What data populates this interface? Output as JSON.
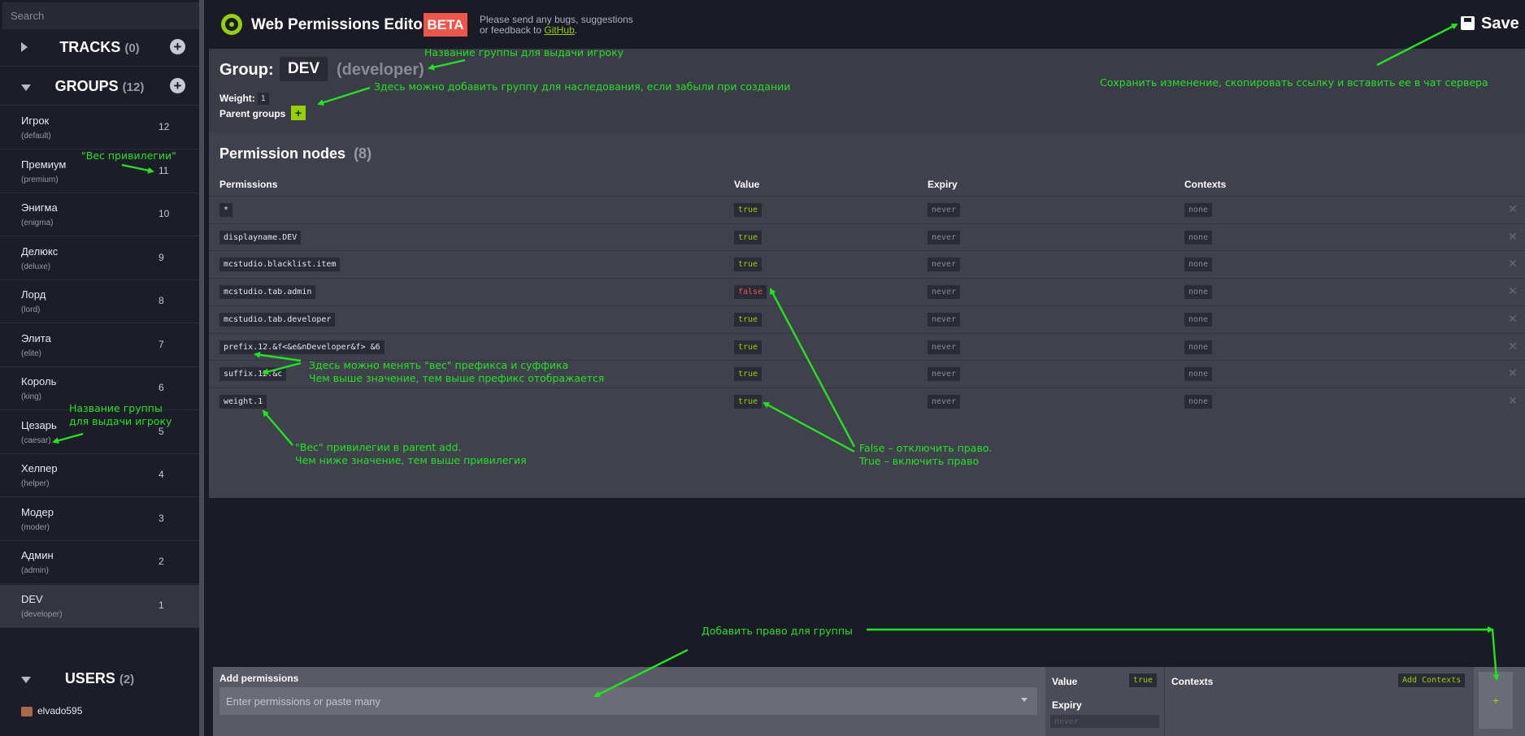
{
  "sidebar": {
    "search_placeholder": "Search",
    "tracks": {
      "title": "TRACKS",
      "count": "(0)"
    },
    "groups": {
      "title": "GROUPS",
      "count": "(12)",
      "items": [
        {
          "name": "Игрок",
          "id": "(default)",
          "weight": "12"
        },
        {
          "name": "Премиум",
          "id": "(premium)",
          "weight": "11"
        },
        {
          "name": "Энигма",
          "id": "(enigma)",
          "weight": "10"
        },
        {
          "name": "Делюкс",
          "id": "(deluxe)",
          "weight": "9"
        },
        {
          "name": "Лорд",
          "id": "(lord)",
          "weight": "8"
        },
        {
          "name": "Элита",
          "id": "(elite)",
          "weight": "7"
        },
        {
          "name": "Король",
          "id": "(king)",
          "weight": "6"
        },
        {
          "name": "Цезарь",
          "id": "(caesar)",
          "weight": "5"
        },
        {
          "name": "Хелпер",
          "id": "(helper)",
          "weight": "4"
        },
        {
          "name": "Модер",
          "id": "(moder)",
          "weight": "3"
        },
        {
          "name": "Админ",
          "id": "(admin)",
          "weight": "2"
        },
        {
          "name": "DEV",
          "id": "(developer)",
          "weight": "1",
          "active": true
        }
      ]
    },
    "users": {
      "title": "USERS",
      "count": "(2)",
      "items": [
        {
          "name": "elvado595"
        }
      ]
    }
  },
  "header": {
    "app_title": "Web Permissions Editor",
    "beta": "BETA",
    "feedback_line1": "Please send any bugs, suggestions",
    "feedback_line2_prefix": "or feedback to ",
    "feedback_link": "GitHub",
    "feedback_suffix": ".",
    "save_label": "Save"
  },
  "group": {
    "label": "Group:",
    "name": "DEV",
    "display_name": "(developer)",
    "weight_label": "Weight:",
    "weight_value": "1",
    "parent_groups_label": "Parent groups",
    "parent_add": "+"
  },
  "permissions": {
    "title": "Permission nodes",
    "count": "(8)",
    "columns": {
      "permission": "Permissions",
      "value": "Value",
      "expiry": "Expiry",
      "contexts": "Contexts"
    },
    "rows": [
      {
        "node": "*",
        "value": "true",
        "expiry": "never",
        "contexts": "none"
      },
      {
        "node": "displayname.DEV",
        "value": "true",
        "expiry": "never",
        "contexts": "none"
      },
      {
        "node": "mcstudio.blacklist.item",
        "value": "true",
        "expiry": "never",
        "contexts": "none"
      },
      {
        "node": "mcstudio.tab.admin",
        "value": "false",
        "expiry": "never",
        "contexts": "none"
      },
      {
        "node": "mcstudio.tab.developer",
        "value": "true",
        "expiry": "never",
        "contexts": "none"
      },
      {
        "node": "prefix.12.&f<&e&nDeveloper&f> &6",
        "value": "true",
        "expiry": "never",
        "contexts": "none"
      },
      {
        "node": "suffix.12.&c",
        "value": "true",
        "expiry": "never",
        "contexts": "none"
      },
      {
        "node": "weight.1",
        "value": "true",
        "expiry": "never",
        "contexts": "none"
      }
    ],
    "delete_glyph": "✕"
  },
  "add": {
    "label": "Add permissions",
    "placeholder": "Enter permissions or paste many",
    "value_label": "Value",
    "value_chip": "true",
    "expiry_label": "Expiry",
    "expiry_placeholder": "never",
    "contexts_label": "Contexts",
    "add_contexts": "Add Contexts",
    "submit": "+"
  },
  "annotations": {
    "group_name_top": "Название группы для выдачи игроку",
    "parent_groups_hint": "Здесь можно добавить группу для наследования, если забыли при создании",
    "save_hint": "Сохранить изменение, скопировать ссылку и вставить ее в чат сервера",
    "weight_privilege": "\"Вес привилегии\"",
    "group_name_left_1": "Название группы",
    "group_name_left_2": "для выдачи игроку",
    "prefix_1": "Здесь можно менять \"вес\" префикса и суффика",
    "prefix_2": "Чем выше значение, тем выше префикс отображается",
    "weight_parent_1": "\"Вес\" привилегии в parent add.",
    "weight_parent_2": "Чем ниже значение, тем выше привилегия",
    "true_false_1": "False – отключить право.",
    "true_false_2": "True – включить право",
    "add_perm": "Добавить право для группы"
  },
  "colors": {
    "accent": "#94d000",
    "danger": "#f0554a",
    "annotation": "#1ee51e"
  }
}
